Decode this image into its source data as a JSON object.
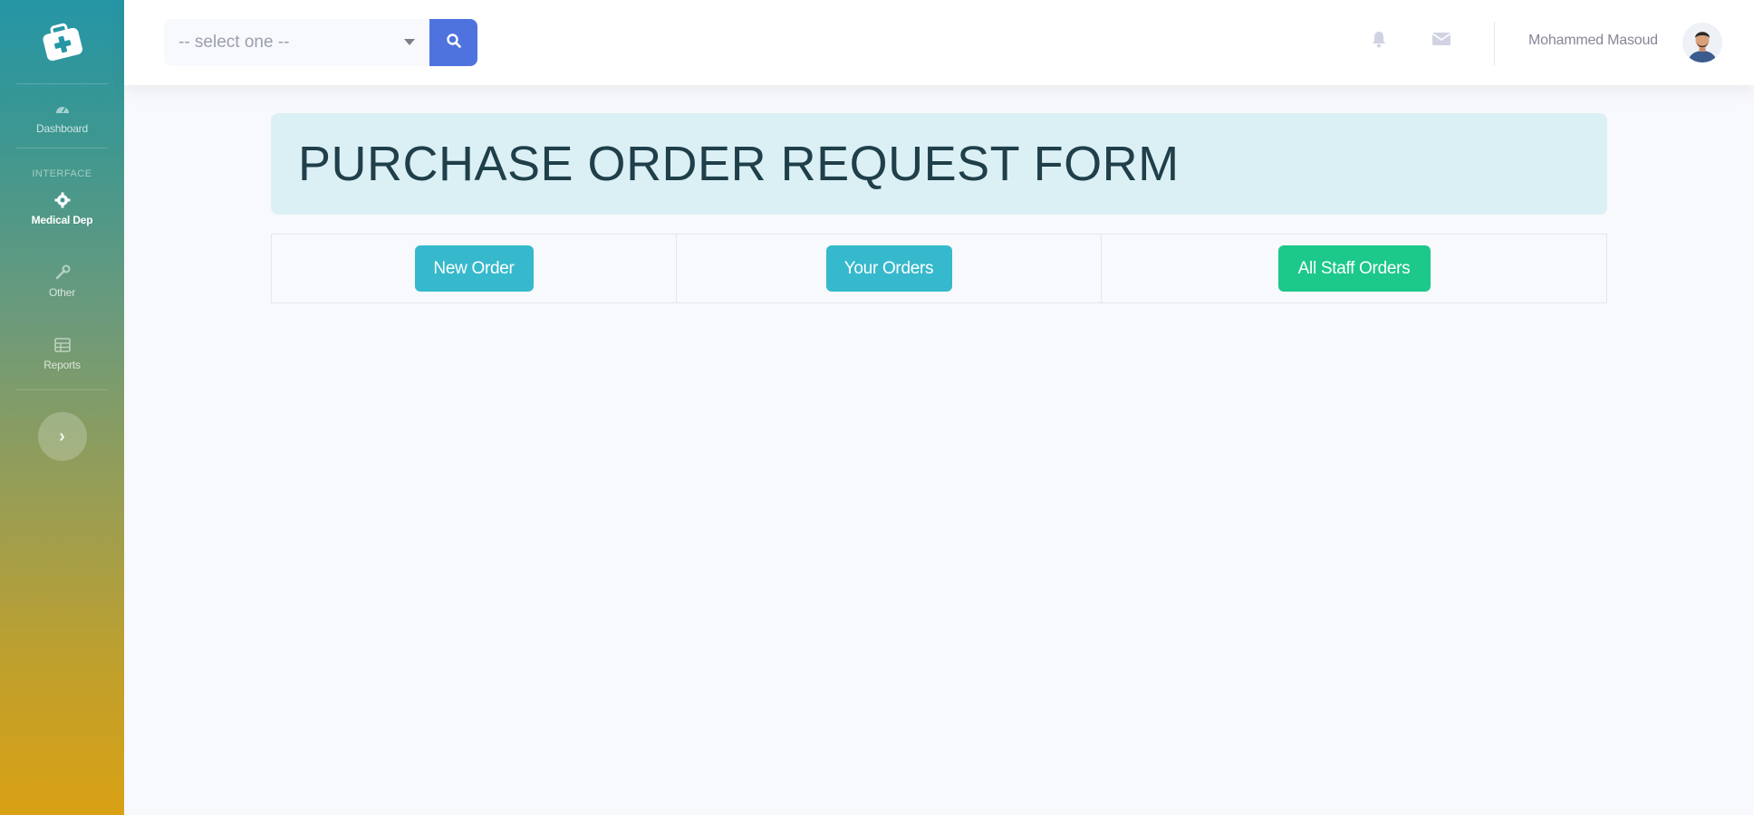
{
  "sidebar": {
    "brand_icon": "medical-kit-icon",
    "items": [
      {
        "label": "Dashboard",
        "icon": "dashboard-icon"
      },
      {
        "label": "Medical Dep",
        "icon": "gear-icon"
      },
      {
        "label": "Other",
        "icon": "wrench-icon"
      },
      {
        "label": "Reports",
        "icon": "table-icon"
      }
    ],
    "heading": "INTERFACE",
    "toggle_label": "›"
  },
  "topbar": {
    "select": {
      "value": "-- select one --"
    },
    "search_icon": "search-icon",
    "bell_icon": "bell-icon",
    "mail_icon": "envelope-icon",
    "username": "Mohammed Masoud"
  },
  "main": {
    "title": "PURCHASE ORDER REQUEST FORM",
    "actions": [
      {
        "label": "New Order"
      },
      {
        "label": "Your Orders"
      },
      {
        "label": "All Staff Orders"
      }
    ]
  },
  "colors": {
    "primary": "#4e73df",
    "info": "#36b9cc",
    "success": "#1cc88a",
    "header_bg": "#dbf0f5"
  }
}
